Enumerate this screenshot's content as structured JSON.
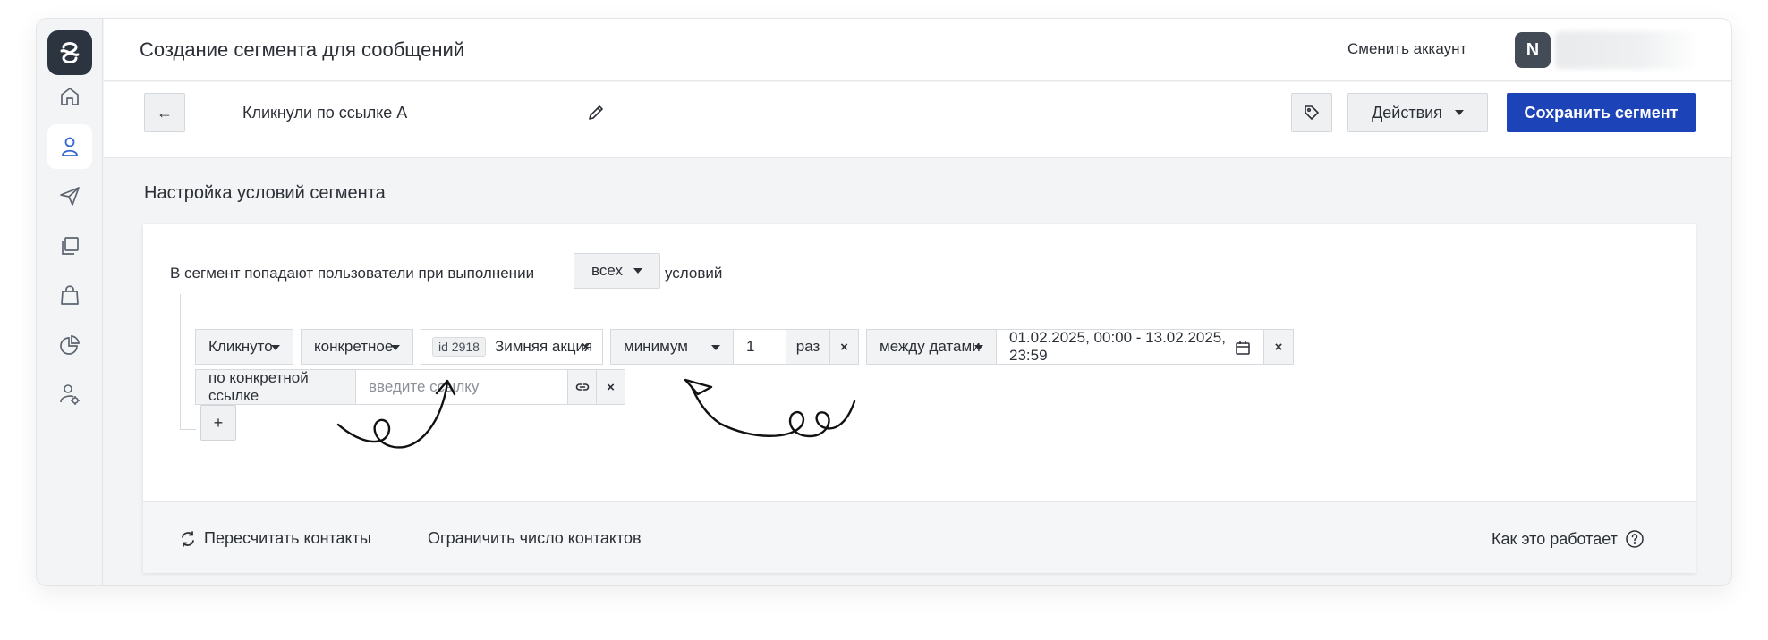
{
  "header": {
    "page_title": "Создание сегмента для сообщений",
    "switch_account_label": "Сменить аккаунт",
    "avatar_letter": "N"
  },
  "sidebar": {
    "items": [
      {
        "icon": "home-icon",
        "active": false
      },
      {
        "icon": "user-icon",
        "active": true
      },
      {
        "icon": "send-icon",
        "active": false
      },
      {
        "icon": "copy-icon",
        "active": false
      },
      {
        "icon": "bag-icon",
        "active": false
      },
      {
        "icon": "pie-chart-icon",
        "active": false
      },
      {
        "icon": "user-settings-icon",
        "active": false
      }
    ]
  },
  "toolbar": {
    "back_icon": "←",
    "segment_name": "Кликнули по ссылке А",
    "actions_label": "Действия",
    "save_label": "Сохранить сегмент"
  },
  "section": {
    "title": "Настройка условий сегмента"
  },
  "conditions": {
    "intro_text": "В сегмент попадают пользователи при выполнении",
    "match_mode": "всех",
    "intro_suffix": "условий",
    "rule": {
      "event": "Кликнуто",
      "target_mode": "конкретное",
      "campaign_id": "id 2918",
      "campaign_name": "Зимняя акция",
      "count_mode": "минимум",
      "count_value": "1",
      "count_unit": "раз",
      "date_mode": "между датами",
      "date_range": "01.02.2025, 00:00 - 13.02.2025, 23:59",
      "remove_label": "×"
    },
    "link_rule": {
      "label": "по конкретной ссылке",
      "placeholder": "введите ссылку",
      "remove_label": "×"
    },
    "add_label": "+"
  },
  "footer": {
    "recalc_label": "Пересчитать контакты",
    "limit_label": "Ограничить число контактов",
    "howto_label": "Как это работает"
  },
  "colors": {
    "accent": "#1c43b8",
    "logo_bg": "#2c3440",
    "active_icon": "#3566d6"
  }
}
